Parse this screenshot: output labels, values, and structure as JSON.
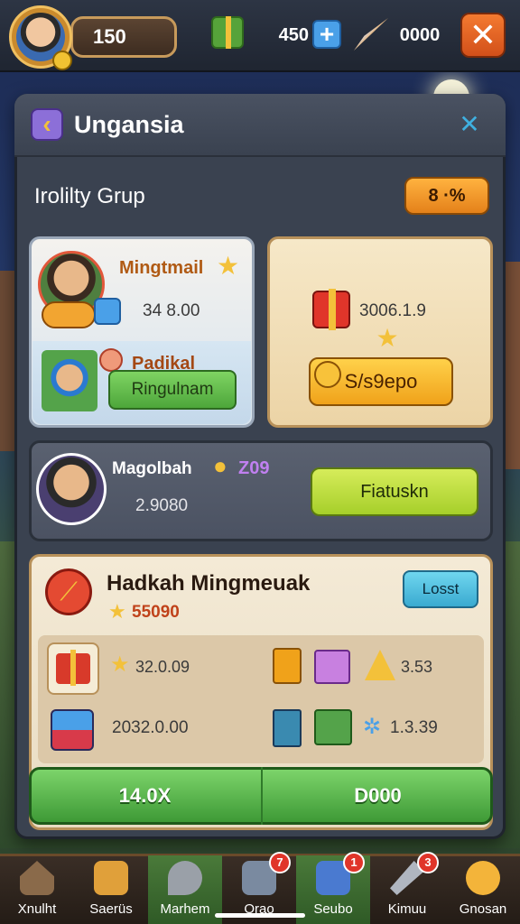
{
  "topbar": {
    "level": "150",
    "gems": "450",
    "plus": "+",
    "points": "0000",
    "close": "✕"
  },
  "panel": {
    "back": "‹",
    "title": "Ungansia",
    "close": "✕",
    "section_title": "Irolilty Grup",
    "section_badge": "8 ·%"
  },
  "card1": {
    "name": "Mingtmail",
    "value": "34 8.00",
    "name2": "Padikal",
    "button": "Ringulnam"
  },
  "card2": {
    "value": "3006.1.9",
    "button": "S/s9epo"
  },
  "member": {
    "name": "Magolbah",
    "tag": "Z09",
    "value": "2.9080",
    "button": "Fiatuskn"
  },
  "reward": {
    "title": "Hadkah Mingmeuak",
    "points": "55090",
    "lost_button": "Losst",
    "value1": "32.0.09",
    "value2": "3.53",
    "value3": "2032.0.00",
    "value4": "1.3.39",
    "big_left": "14.0X",
    "big_right": "D000"
  },
  "nav": [
    {
      "label": "Xnulht",
      "badge": ""
    },
    {
      "label": "Saerüs",
      "badge": ""
    },
    {
      "label": "Marhem",
      "badge": ""
    },
    {
      "label": "Orao",
      "badge": "7"
    },
    {
      "label": "Seubo",
      "badge": "1"
    },
    {
      "label": "Kimuu",
      "badge": "3"
    },
    {
      "label": "Gnosan",
      "badge": ""
    }
  ],
  "colors": {
    "accent_orange": "#f47a30",
    "green_button": "#4da63a",
    "gold": "#f3c13a"
  }
}
